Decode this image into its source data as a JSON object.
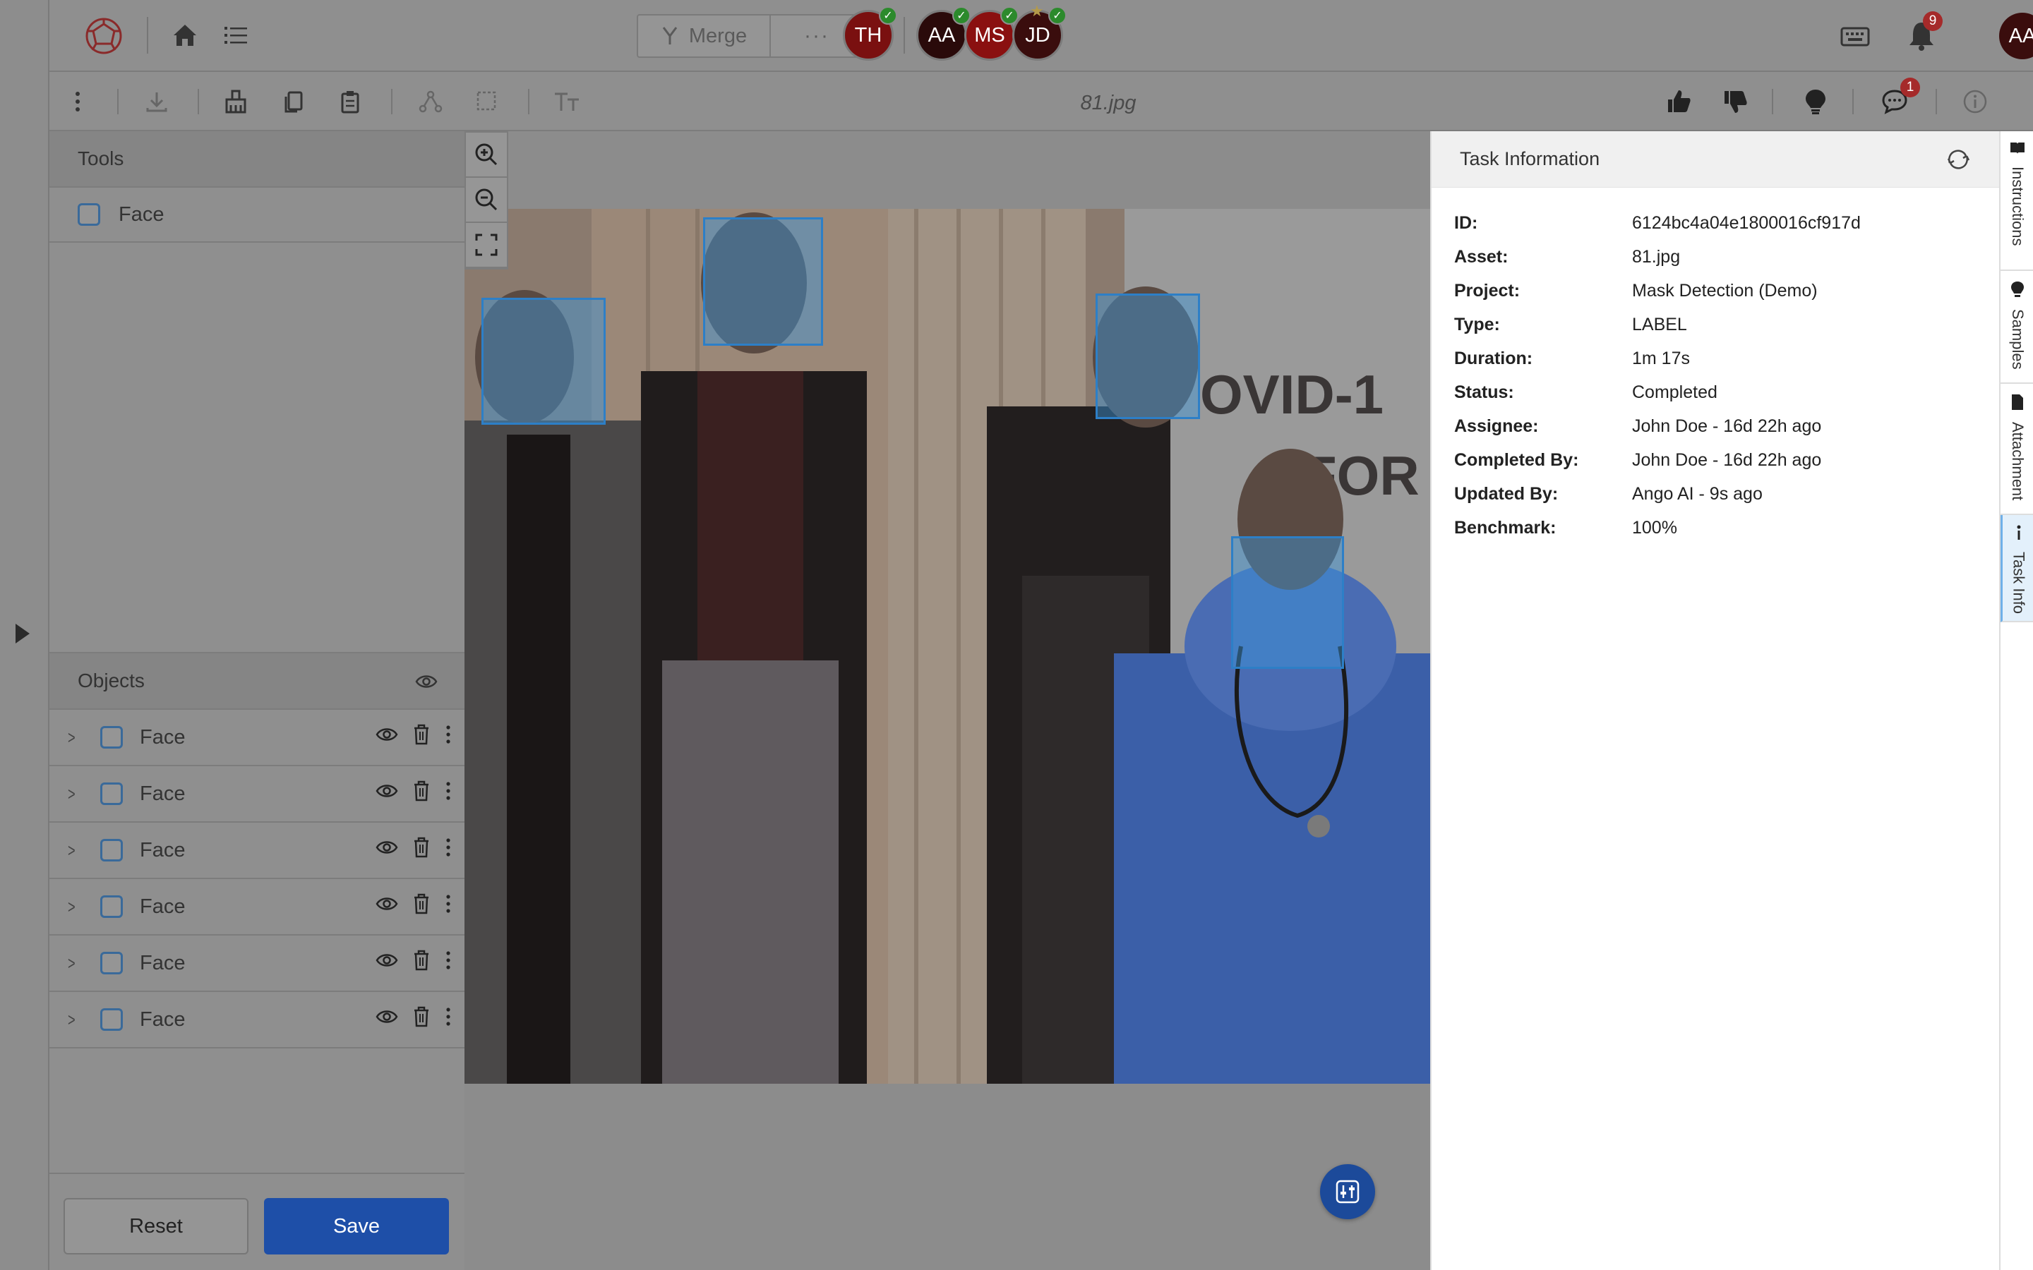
{
  "topbar": {
    "merge_label": "Merge",
    "merge_more": "···",
    "collaborators": [
      {
        "initials": "TH",
        "color": "#7a1010",
        "checked": true,
        "star": false
      },
      {
        "initials": "AA",
        "color": "#2a0a0a",
        "checked": true,
        "star": false
      },
      {
        "initials": "MS",
        "color": "#8a1010",
        "checked": true,
        "star": false
      },
      {
        "initials": "JD",
        "color": "#3a0d0d",
        "checked": true,
        "star": true
      }
    ],
    "notification_count": "9",
    "user_initials": "AA"
  },
  "toolbar": {
    "filename": "81.jpg",
    "comment_count": "1"
  },
  "tools_panel": {
    "title": "Tools",
    "tools": [
      {
        "label": "Face"
      }
    ]
  },
  "objects_panel": {
    "title": "Objects",
    "objects": [
      {
        "label": "Face"
      },
      {
        "label": "Face"
      },
      {
        "label": "Face"
      },
      {
        "label": "Face"
      },
      {
        "label": "Face"
      },
      {
        "label": "Face"
      }
    ]
  },
  "actions": {
    "reset_label": "Reset",
    "save_label": "Save"
  },
  "task_info": {
    "title": "Task Information",
    "fields": [
      {
        "key": "ID:",
        "value": "6124bc4a04e1800016cf917d"
      },
      {
        "key": "Asset:",
        "value": "81.jpg"
      },
      {
        "key": "Project:",
        "value": "Mask Detection (Demo)"
      },
      {
        "key": "Type:",
        "value": "LABEL"
      },
      {
        "key": "Duration:",
        "value": "1m 17s"
      },
      {
        "key": "Status:",
        "value": "Completed"
      },
      {
        "key": "Assignee:",
        "value": "John Doe - 16d 22h ago"
      },
      {
        "key": "Completed By:",
        "value": "John Doe - 16d 22h ago"
      },
      {
        "key": "Updated By:",
        "value": "Ango AI - 9s ago"
      },
      {
        "key": "Benchmark:",
        "value": "100%"
      }
    ]
  },
  "side_tabs": [
    {
      "label": "Instructions",
      "icon": "book-icon"
    },
    {
      "label": "Samples",
      "icon": "bulb-icon"
    },
    {
      "label": "Attachment",
      "icon": "file-icon"
    },
    {
      "label": "Task Info",
      "icon": "info-icon",
      "active": true
    }
  ],
  "photo": {
    "banner_line1": "OVID-1",
    "banner_line2": "FOR"
  },
  "colors": {
    "save_blue": "#1e4fa8",
    "bbox_blue": "#2d7fc7",
    "badge_red": "#a52a2a"
  }
}
